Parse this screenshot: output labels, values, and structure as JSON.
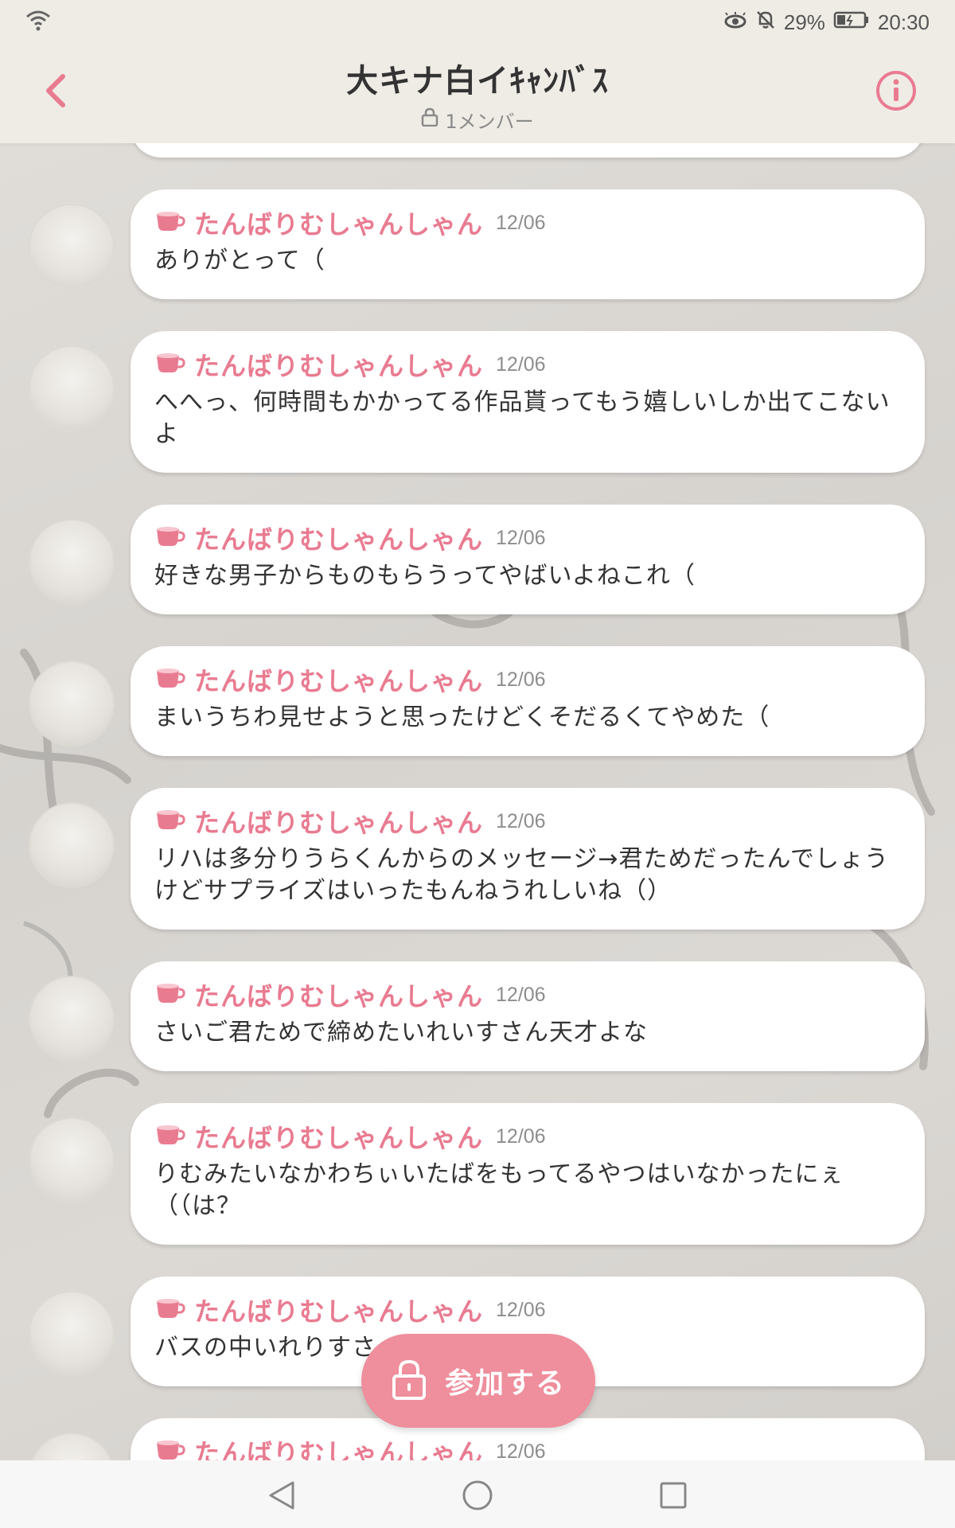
{
  "status_bar": {
    "battery": "29%",
    "time": "20:30"
  },
  "header": {
    "title": "大キナ白イｷｬﾝﾊﾞｽ",
    "member_count": "1メンバー"
  },
  "messages": [
    {
      "name": "たんばりむしゃんしゃん",
      "date": "12/06",
      "text": "ありがとって（"
    },
    {
      "name": "たんばりむしゃんしゃん",
      "date": "12/06",
      "text": "へへっ、何時間もかかってる作品貰ってもう嬉しいしか出てこないよ"
    },
    {
      "name": "たんばりむしゃんしゃん",
      "date": "12/06",
      "text": "好きな男子からものもらうってやばいよねこれ（"
    },
    {
      "name": "たんばりむしゃんしゃん",
      "date": "12/06",
      "text": "まいうちわ見せようと思ったけどくそだるくてやめた（"
    },
    {
      "name": "たんばりむしゃんしゃん",
      "date": "12/06",
      "text": "リハは多分りうらくんからのメッセージ→君ためだったんでしょうけどサプライズはいったもんねうれしいね（）"
    },
    {
      "name": "たんばりむしゃんしゃん",
      "date": "12/06",
      "text": "さいご君ためで締めたいれいすさん天才よな"
    },
    {
      "name": "たんばりむしゃんしゃん",
      "date": "12/06",
      "text": "りむみたいなかわちぃいたばをもってるやつはいなかったにぇ（（は？"
    },
    {
      "name": "たんばりむしゃんしゃん",
      "date": "12/06",
      "text": "バスの中いれりすさ　　　　　　ぇ"
    },
    {
      "name": "たんばりむしゃんしゃん",
      "date": "12/06",
      "text": ""
    }
  ],
  "join_button": {
    "label": "参加する"
  },
  "colors": {
    "accent": "#e97b91",
    "join_button": "#ef8e9c",
    "header_bg": "#efece6"
  }
}
